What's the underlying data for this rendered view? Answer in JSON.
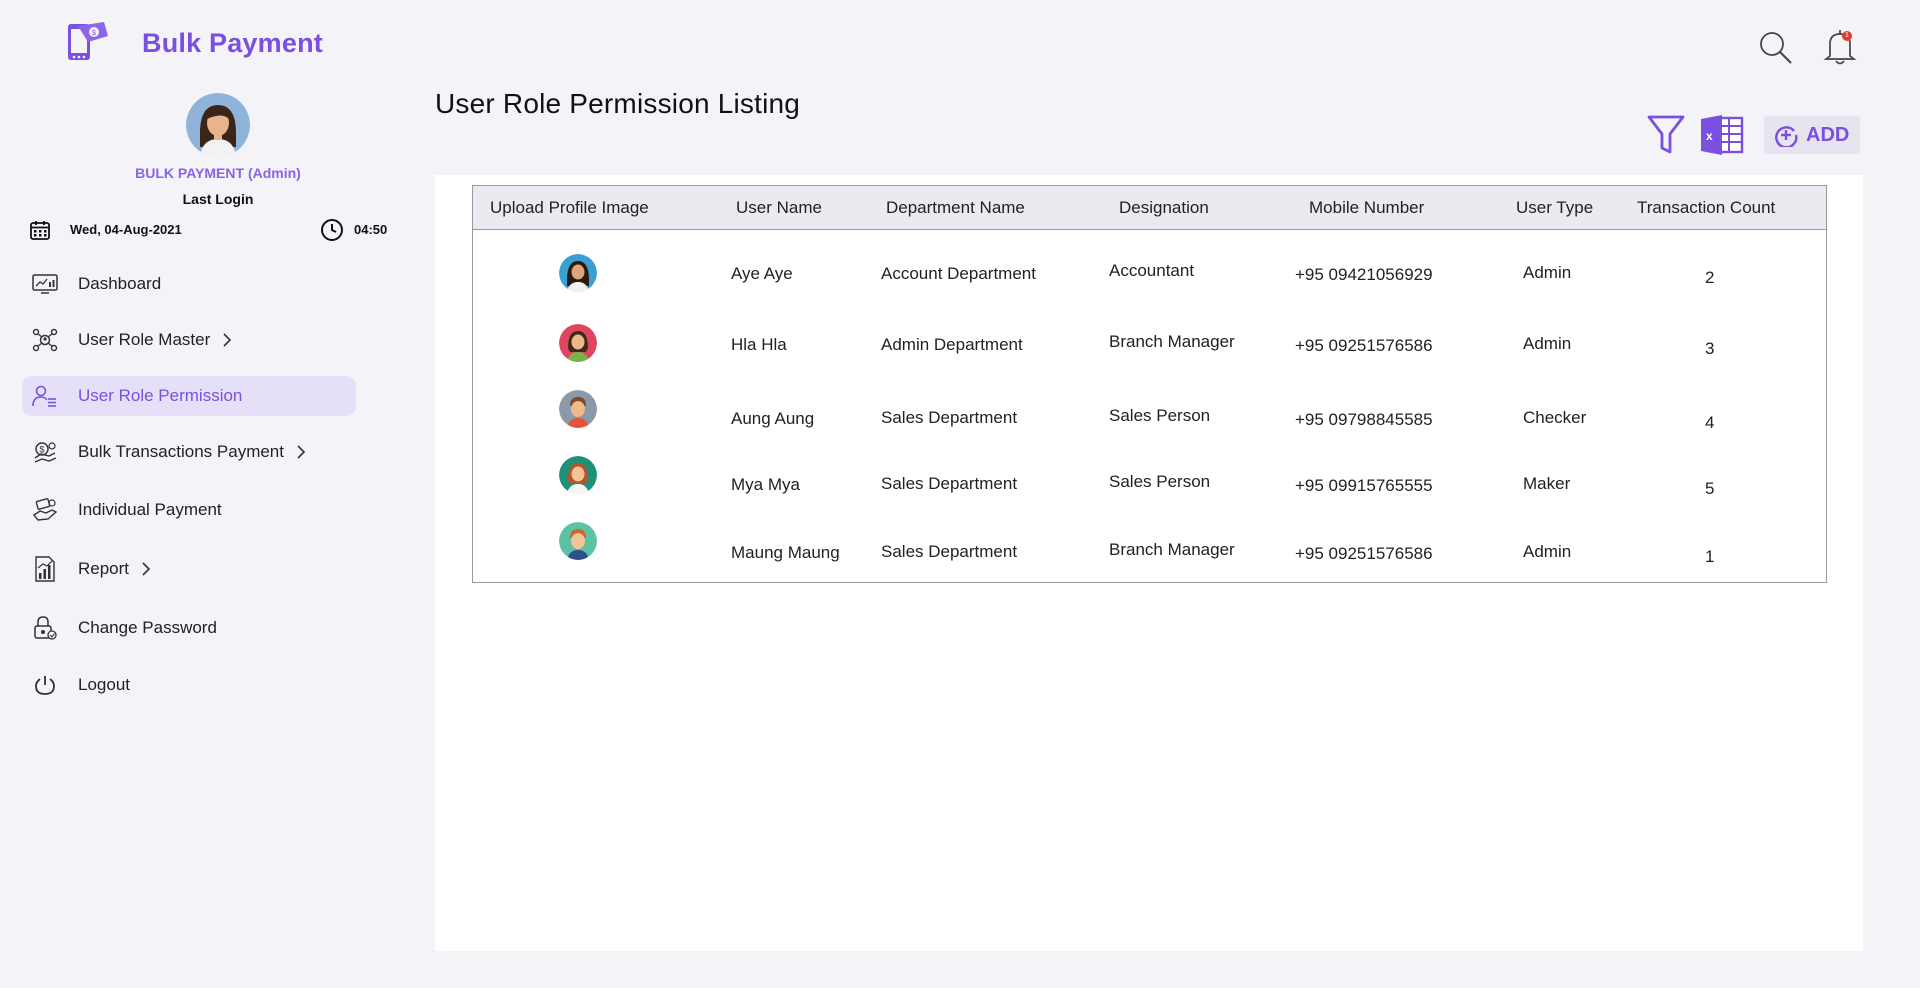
{
  "app": {
    "title": "Bulk Payment",
    "accent": "#7b4fe0"
  },
  "profile": {
    "name": "BULK PAYMENT (Admin)",
    "last_login_label": "Last Login",
    "date": "Wed, 04-Aug-2021",
    "time": "04:50"
  },
  "sidebar": {
    "items": [
      {
        "label": "Dashboard",
        "icon": "dashboard-icon",
        "has_submenu": false,
        "active": false
      },
      {
        "label": "User Role Master",
        "icon": "user-role-master-icon",
        "has_submenu": true,
        "active": false
      },
      {
        "label": "User Role Permission",
        "icon": "user-permission-icon",
        "has_submenu": false,
        "active": true
      },
      {
        "label": "Bulk Transactions Payment",
        "icon": "bulk-transactions-icon",
        "has_submenu": true,
        "active": false
      },
      {
        "label": "Individual Payment",
        "icon": "individual-payment-icon",
        "has_submenu": false,
        "active": false
      },
      {
        "label": "Report",
        "icon": "report-icon",
        "has_submenu": true,
        "active": false
      },
      {
        "label": "Change Password",
        "icon": "lock-icon",
        "has_submenu": false,
        "active": false
      },
      {
        "label": "Logout",
        "icon": "power-icon",
        "has_submenu": false,
        "active": false
      }
    ]
  },
  "header": {
    "search_icon": "search-icon",
    "bell_icon": "bell-icon",
    "notification_count": "1"
  },
  "page": {
    "title": "User Role Permission Listing"
  },
  "toolbar": {
    "filter_icon": "filter-icon",
    "export_icon": "excel-icon",
    "add_label": "ADD"
  },
  "table": {
    "columns": [
      "Upload Profile Image",
      "User Name",
      "Department Name",
      "Designation",
      "Mobile Number",
      "User Type",
      "Transaction Count"
    ],
    "rows": [
      {
        "avatar": "female-avatar-1",
        "user_name": "Aye Aye",
        "department": "Account Department",
        "designation": "Accountant",
        "mobile": "+95 09421056929",
        "user_type": "Admin",
        "count": "2"
      },
      {
        "avatar": "female-avatar-2",
        "user_name": "Hla Hla",
        "department": "Admin Department",
        "designation": "Branch Manager",
        "mobile": "+95 09251576586",
        "user_type": "Admin",
        "count": "3"
      },
      {
        "avatar": "male-avatar-1",
        "user_name": "Aung Aung",
        "department": "Sales Department",
        "designation": "Sales Person",
        "mobile": "+95 09798845585",
        "user_type": "Checker",
        "count": "4"
      },
      {
        "avatar": "female-avatar-3",
        "user_name": "Mya Mya",
        "department": "Sales Department",
        "designation": "Sales Person",
        "mobile": "+95 09915765555",
        "user_type": "Maker",
        "count": "5"
      },
      {
        "avatar": "male-avatar-2",
        "user_name": "Maung Maung",
        "department": "Sales Department",
        "designation": "Branch Manager",
        "mobile": "+95 09251576586",
        "user_type": "Admin",
        "count": "1"
      }
    ]
  }
}
